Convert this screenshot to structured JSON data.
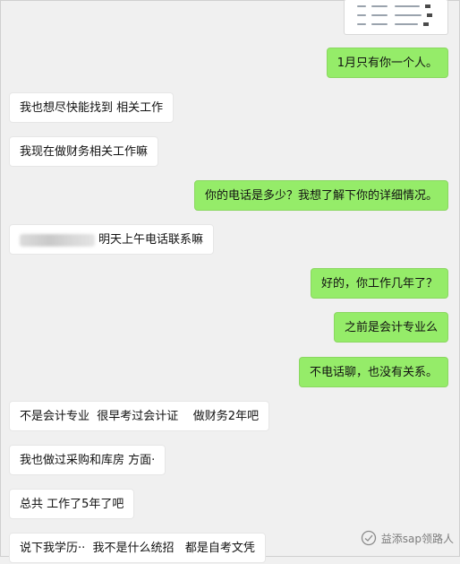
{
  "watermark": {
    "text": "益添sap领路人",
    "icon": "wechat-public-account-icon"
  },
  "messages": [
    {
      "dir": "out",
      "text": "1月只有你一个人。"
    },
    {
      "dir": "in",
      "text": "我也想尽快能找到 相关工作"
    },
    {
      "dir": "in",
      "text": "我现在做财务相关工作嘛"
    },
    {
      "dir": "out",
      "text": "你的电话是多少？我想了解下你的详细情况。"
    },
    {
      "dir": "in",
      "text": "明天上午电话联系嘛",
      "redacted_prefix": true
    },
    {
      "dir": "out",
      "text": "好的，你工作几年了？"
    },
    {
      "dir": "out",
      "text": "之前是会计专业么"
    },
    {
      "dir": "out",
      "text": "不电话聊，也没有关系。"
    },
    {
      "dir": "in",
      "text": "不是会计专业  很早考过会计证    做财务2年吧"
    },
    {
      "dir": "in",
      "text": "我也做过采购和库房 方面·"
    },
    {
      "dir": "in",
      "text": "总共 工作了5年了吧"
    },
    {
      "dir": "in",
      "text": "说下我学历··  我不是什么统招   都是自考文凭"
    }
  ]
}
